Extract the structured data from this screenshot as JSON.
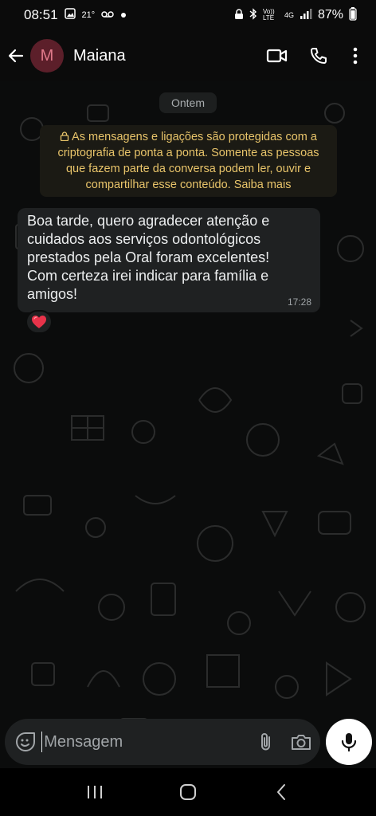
{
  "status_bar": {
    "time": "08:51",
    "temperature": "21°",
    "battery_percent": "87%",
    "signal_labels": [
      "Vo)) LTE",
      "4G"
    ]
  },
  "header": {
    "avatar_initial": "M",
    "contact_name": "Maiana",
    "icons": [
      "back-arrow-icon",
      "video-call-icon",
      "voice-call-icon",
      "more-options-icon"
    ]
  },
  "chat": {
    "date_label": "Ontem",
    "encryption_notice": "As mensagens e ligações são protegidas com a criptografia de ponta a ponta. Somente as pessoas que fazem parte da conversa podem ler, ouvir e compartilhar esse conteúdo. Saiba mais",
    "messages": [
      {
        "text": "Boa tarde, quero agradecer atenção e cuidados aos serviços odontológicos prestados pela Oral foram excelentes! Com certeza irei indicar para família e amigos!",
        "time": "17:28",
        "reaction": "❤️"
      }
    ]
  },
  "composer": {
    "placeholder": "Mensagem",
    "value": ""
  },
  "colors": {
    "background": "#0b0c0c",
    "bubble": "#1f2122",
    "notice_text": "#e8c46a",
    "avatar_bg": "#5c1f2a",
    "avatar_text": "#e07a8a"
  }
}
